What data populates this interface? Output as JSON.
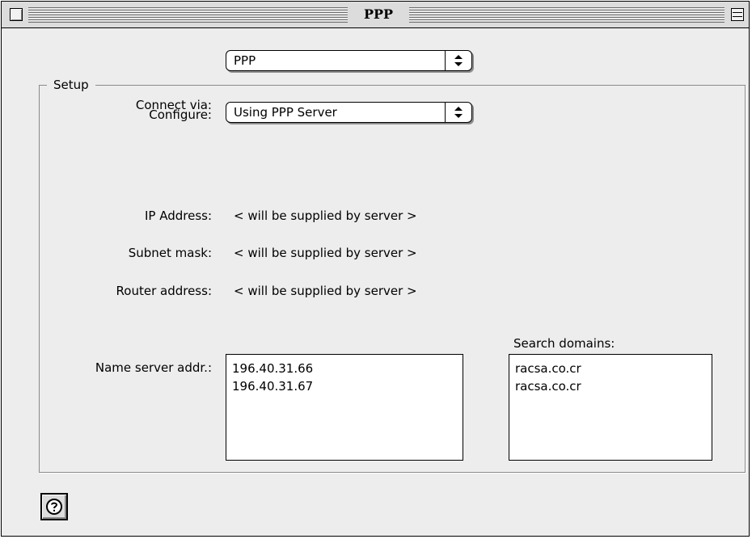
{
  "window": {
    "title": "PPP"
  },
  "connect": {
    "label": "Connect via:",
    "value": "PPP"
  },
  "setup": {
    "title": "Setup",
    "configure_label": "Configure:",
    "configure_value": "Using PPP Server",
    "ip_label": "IP Address:",
    "ip_value": "< will be supplied by server >",
    "subnet_label": "Subnet mask:",
    "subnet_value": "< will be supplied by server >",
    "router_label": "Router address:",
    "router_value": "< will be supplied by server >",
    "nameserver_label": "Name server addr.:",
    "nameservers": [
      "196.40.31.66",
      "196.40.31.67"
    ],
    "search_label": "Search domains:",
    "search_domains": [
      "racsa.co.cr",
      "racsa.co.cr"
    ]
  },
  "icons": [
    "close-box-icon",
    "collapse-box-icon",
    "popup-arrows-icon",
    "help-icon"
  ]
}
